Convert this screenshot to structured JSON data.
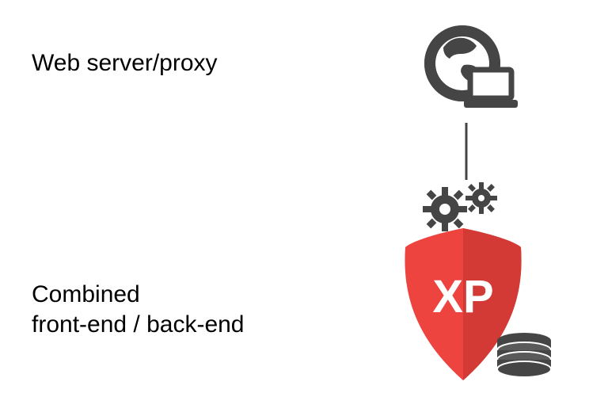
{
  "diagram": {
    "top_label": "Web server/proxy",
    "bottom_label_line1": "Combined",
    "bottom_label_line2": "front-end / back-end",
    "badge_text": "XP",
    "colors": {
      "icon_gray": "#454545",
      "shield_red": "#ee4440",
      "shield_red_dark": "#d33a36",
      "badge_text_color": "#ffffff"
    }
  }
}
